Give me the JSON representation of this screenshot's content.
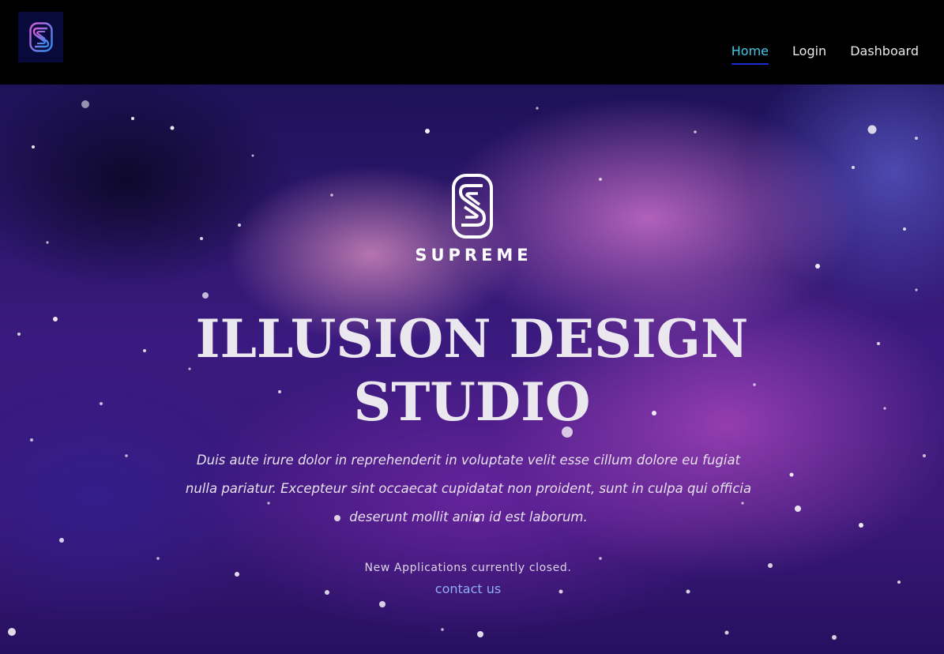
{
  "nav": {
    "logo_icon": "supreme-s-logo-icon",
    "links": [
      {
        "label": "Home",
        "active": true
      },
      {
        "label": "Login",
        "active": false
      },
      {
        "label": "Dashboard",
        "active": false
      }
    ]
  },
  "hero": {
    "brand_icon": "supreme-s-monogram-icon",
    "brand_name": "SUPREME",
    "title_line1": "ILLUSION DESIGN",
    "title_line2": "STUDIO",
    "description": "Duis aute irure dolor in reprehenderit in voluptate velit esse cillum dolore eu fugiat nulla pariatur. Excepteur sint occaecat cupidatat non proident, sunt in culpa qui officia deserunt mollit anim id est laborum.",
    "note": "New Applications currently closed.",
    "contact_label": "contact us"
  },
  "colors": {
    "nav_background": "#000000",
    "logo_background": "#070a3a",
    "active_link": "#45c7e6",
    "active_underline": "#1c2bd1",
    "contact_link": "#8fb0f2"
  }
}
